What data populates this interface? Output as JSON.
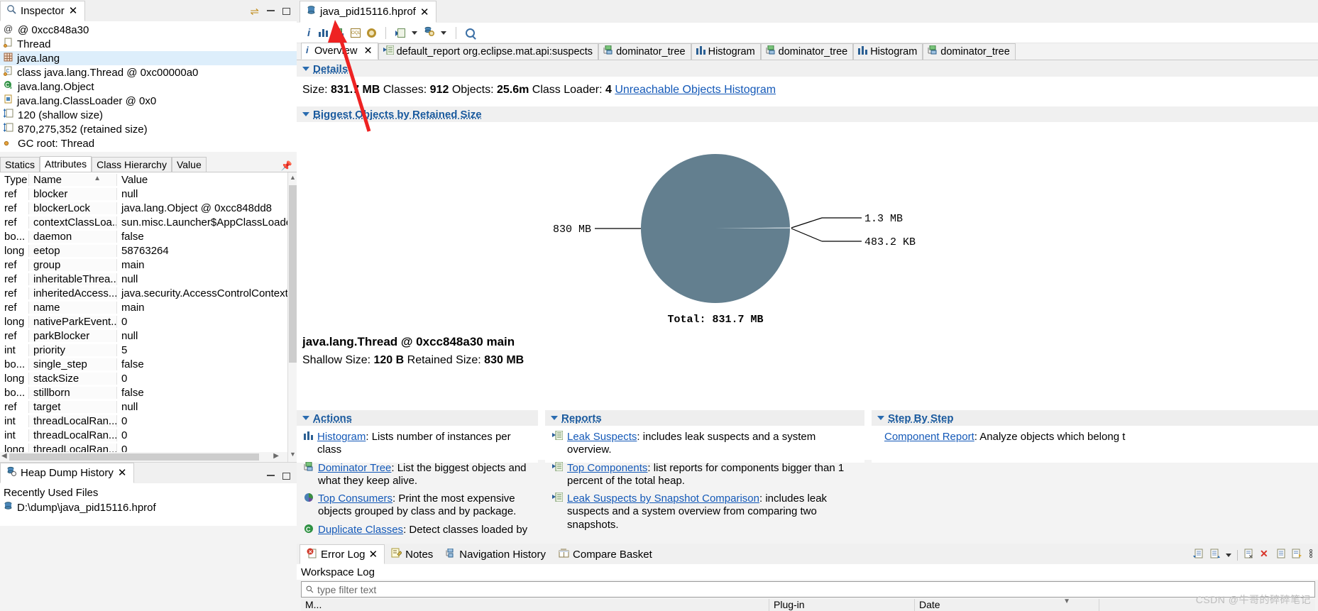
{
  "inspector": {
    "tab_label": "Inspector",
    "close": "✕",
    "rows": [
      {
        "icon": "at-icon",
        "label": "@ 0xcc848a30"
      },
      {
        "icon": "thread-icon",
        "label": "Thread"
      },
      {
        "icon": "package-icon",
        "label": "java.lang"
      },
      {
        "icon": "class-icon",
        "label": "class java.lang.Thread @ 0xc00000a0"
      },
      {
        "icon": "superclass-icon",
        "label": "java.lang.Object"
      },
      {
        "icon": "classloader-icon",
        "label": "java.lang.ClassLoader @ 0x0"
      },
      {
        "icon": "size-icon",
        "label": "120 (shallow size)"
      },
      {
        "icon": "size-icon",
        "label": "870,275,352 (retained size)"
      },
      {
        "icon": "gcroot-icon",
        "label": "GC root: Thread"
      }
    ],
    "attr_tabs": [
      {
        "label": "Statics",
        "active": false
      },
      {
        "label": "Attributes",
        "active": true
      },
      {
        "label": "Class Hierarchy",
        "active": false
      },
      {
        "label": "Value",
        "active": false
      }
    ],
    "table": {
      "columns": [
        "Type",
        "Name",
        "Value"
      ],
      "rows": [
        [
          "ref",
          "blocker",
          "null"
        ],
        [
          "ref",
          "blockerLock",
          "java.lang.Object @ 0xcc848dd8"
        ],
        [
          "ref",
          "contextClassLoa...",
          "sun.misc.Launcher$AppClassLoader .."
        ],
        [
          "bo...",
          "daemon",
          "false"
        ],
        [
          "long",
          "eetop",
          "58763264"
        ],
        [
          "ref",
          "group",
          "main"
        ],
        [
          "ref",
          "inheritableThrea...",
          "null"
        ],
        [
          "ref",
          "inheritedAccess...",
          "java.security.AccessControlContext ..."
        ],
        [
          "ref",
          "name",
          "main"
        ],
        [
          "long",
          "nativeParkEvent...",
          "0"
        ],
        [
          "ref",
          "parkBlocker",
          "null"
        ],
        [
          "int",
          "priority",
          "5"
        ],
        [
          "bo...",
          "single_step",
          "false"
        ],
        [
          "long",
          "stackSize",
          "0"
        ],
        [
          "bo...",
          "stillborn",
          "false"
        ],
        [
          "ref",
          "target",
          "null"
        ],
        [
          "int",
          "threadLocalRan...",
          "0"
        ],
        [
          "int",
          "threadLocalRan...",
          "0"
        ],
        [
          "long",
          "threadLocalRan...",
          "0"
        ]
      ]
    }
  },
  "heap_history": {
    "tab_label": "Heap Dump History",
    "close": "✕",
    "heading": "Recently Used Files",
    "files": [
      "D:\\dump\\java_pid15116.hprof"
    ]
  },
  "editor": {
    "tab_label": "java_pid15116.hprof",
    "close": "✕",
    "toolbar": {
      "overview_label": "i",
      "items": [
        "info-icon",
        "histogram-icon",
        "dominator-tree-icon",
        "oql-icon",
        "gear-icon",
        "report-icon",
        "chevron-down-icon",
        "inspections-icon",
        "chevron-down-icon-2",
        "search-icon"
      ]
    },
    "inner_tabs": [
      {
        "label": "Overview",
        "icon": "info-icon",
        "active": true,
        "closable": true
      },
      {
        "label": "default_report  org.eclipse.mat.api:suspects",
        "icon": "report-icon",
        "active": false,
        "closable": false
      },
      {
        "label": "dominator_tree",
        "icon": "dominator-tree-icon",
        "active": false,
        "closable": false
      },
      {
        "label": "Histogram",
        "icon": "histogram-icon",
        "active": false,
        "closable": false
      },
      {
        "label": "dominator_tree",
        "icon": "dominator-tree-icon",
        "active": false,
        "closable": false
      },
      {
        "label": "Histogram",
        "icon": "histogram-icon",
        "active": false,
        "closable": false
      },
      {
        "label": "dominator_tree",
        "icon": "dominator-tree-icon",
        "active": false,
        "closable": false
      }
    ]
  },
  "overview": {
    "details": {
      "title": "Details",
      "size_label": "Size:",
      "size_value": "831.7 MB",
      "classes_label": "Classes:",
      "classes_value": "912",
      "objects_label": "Objects:",
      "objects_value": "25.6m",
      "classloader_label": "Class Loader:",
      "classloader_value": "4",
      "unreachable_link": "Unreachable Objects Histogram"
    },
    "biggest": {
      "title": "Biggest Objects by Retained Size",
      "object_title": "java.lang.Thread @ 0xcc848a30 main",
      "shallow_label": "Shallow Size:",
      "shallow_value": "120 B",
      "retained_label": "Retained Size:",
      "retained_value": "830 MB"
    },
    "actions": {
      "title": "Actions",
      "items": [
        {
          "icon": "histogram-icon",
          "link": "Histogram",
          "text": ": Lists number of instances per class"
        },
        {
          "icon": "dominator-tree-icon",
          "link": "Dominator Tree",
          "text": ": List the biggest objects and what they keep alive."
        },
        {
          "icon": "top-consumers-icon",
          "link": "Top Consumers",
          "text": ": Print the most expensive objects grouped by class and by package."
        },
        {
          "icon": "duplicate-classes-icon",
          "link": "Duplicate Classes",
          "text": ": Detect classes loaded by"
        }
      ]
    },
    "reports": {
      "title": "Reports",
      "items": [
        {
          "icon": "report-icon",
          "link": "Leak Suspects",
          "text": ": includes leak suspects and a system overview."
        },
        {
          "icon": "report-icon",
          "link": "Top Components",
          "text": ": list reports for components bigger than 1 percent of the total heap."
        },
        {
          "icon": "report-icon",
          "link": "Leak Suspects by Snapshot Comparison",
          "text": ": includes leak suspects and a system overview from comparing two snapshots."
        }
      ]
    },
    "step_by_step": {
      "title": "Step By Step",
      "items": [
        {
          "link": "Component Report",
          "text": ": Analyze objects which belong t"
        }
      ]
    }
  },
  "chart_data": {
    "type": "pie",
    "title": "Biggest Objects by Retained Size",
    "total_label": "Total: 831.7 MB",
    "labels": [
      "830 MB",
      "1.3 MB",
      "483.2 KB"
    ],
    "values": [
      830,
      1.3,
      0.4832
    ],
    "unit": "MB",
    "slice_color": "#637f8f",
    "legend": "none",
    "annotations": [
      "830 MB",
      "1.3 MB",
      "483.2 KB",
      "Total: 831.7 MB"
    ]
  },
  "bottom": {
    "tabs": [
      {
        "label": "Error Log",
        "icon": "error-icon",
        "active": true,
        "closable": true
      },
      {
        "label": "Notes",
        "icon": "notes-icon",
        "active": false,
        "closable": false
      },
      {
        "label": "Navigation History",
        "icon": "navigation-icon",
        "active": false,
        "closable": false
      },
      {
        "label": "Compare Basket",
        "icon": "compare-icon",
        "active": false,
        "closable": false
      }
    ],
    "workspace_log": "Workspace Log",
    "filter_placeholder": "type filter text",
    "log_columns": [
      "M...",
      "Plug-in",
      "Date"
    ]
  },
  "watermark": "CSDN @牛哥的碎碎笔记",
  "colors": {
    "link": "#1459b8",
    "section_title": "#1a5a9e",
    "pie": "#637f8f",
    "selection": "#ddeefb",
    "arrow": "#ee2222"
  }
}
